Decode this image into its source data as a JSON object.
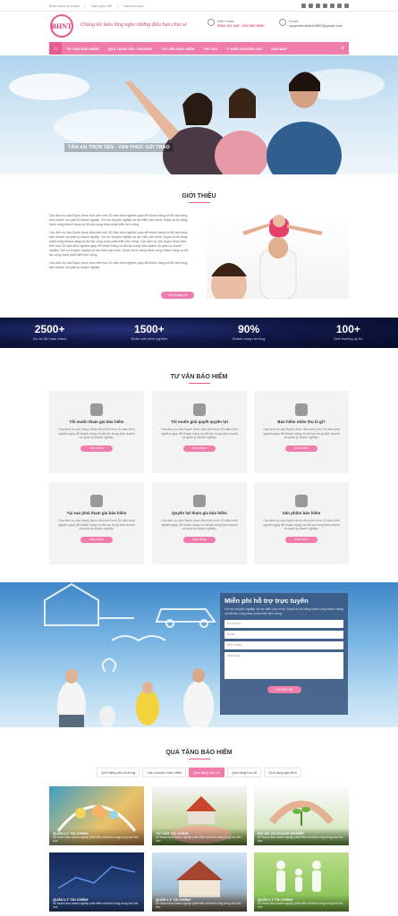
{
  "topbar": {
    "links": [
      "Định sách có thành",
      "Bảo gồm đổi",
      "Các tính sức"
    ]
  },
  "header": {
    "logo": "BHNT",
    "slogan": "Chúng tôi luôn lắng nghe những điều bạn chia sẻ",
    "phone_label": "Điện thoại:",
    "phone_value": "0962 141 108 - 063 800 9000",
    "email_label": "Email:",
    "email_value": "nguyenthuthanh2862@gmail.com"
  },
  "nav": {
    "items": [
      "TƯ VẤN BẢO HIỂM",
      "QUÀ TẶNG YÊU THƯƠNG",
      "TƯ LIỆU BẢO HIỂM",
      "TIN TỨC",
      "Ý KIẾN CHUYÊN GIA",
      "GIẢI ĐÁP"
    ]
  },
  "hero": {
    "caption": "TÂM AN TRỌN VẸN - VẠN PHÚC GỬI TRAO"
  },
  "intro": {
    "title": "GIỚI THIỆU",
    "p1": "Các dịch vụ của Suplo được đưa trên hơn 20 năm kinh nghiệm giúp để khách hàng và đối tác trong kinh doanh và quản lý doanh nghiệp. Với sự chuyên nghiệp và am hiểu của mình, Suplo tự tin đồng hành cùng khách hàng và đối tác cùng nhau phát triển bền vững.",
    "p2": "Các dịch vụ của Suplo được đưa trên hơn 20 năm kinh nghiệm giúp để khách hàng và đối tác trong kinh doanh và quản lý doanh nghiệp. Với sự chuyên nghiệp và am hiểu của mình, Suplo tự tin đồng hành cùng khách hàng và đối tác cùng nhau phát triển bền vững. Các dịch vụ của Suplo được đưa trên hơn 20 năm kinh nghiệm giúp để khách hàng và đối tác trong kinh doanh và quản lý doanh nghiệp. Với sự chuyên nghiệp và am hiểu của mình, Suplo tự tin đồng hành cùng khách hàng và đối tác cùng nhau phát triển bền vững.",
    "p3": "Các dịch vụ của Suplo được đưa trên hơn 20 năm kinh nghiệm giúp để khách hàng và đối tác trong kinh doanh và quản lý doanh nghiệp.",
    "button": "Về chúng tôi"
  },
  "stats": [
    {
      "num": "2500+",
      "label": "Dự án đã hoàn thành"
    },
    {
      "num": "1500+",
      "label": "Nhân viên kinh nghiệm"
    },
    {
      "num": "90%",
      "label": "Khách hàng hài lòng"
    },
    {
      "num": "100+",
      "label": "Giải thưởng uy tín"
    }
  ],
  "advice": {
    "title": "TƯ VẤN BẢO HIỂM",
    "desc": "Các dịch vụ của Suplo được đưa trên hơn 20 năm kinh nghiệm giúp để khách hàng và đối tác trong kinh doanh và quản lý doanh nghiệp.",
    "button": "Xem thêm",
    "cards": [
      {
        "title": "Tôi muốn tham gia bảo hiểm",
        "icon": "document-dollar-icon"
      },
      {
        "title": "Tôi muốn giải quyết quyền lợi",
        "icon": "shield-check-icon"
      },
      {
        "title": "Bảo hiểm nhân thọ là gì?",
        "icon": "chat-bubble-icon"
      },
      {
        "title": "Tại sao phải tham gia bảo hiểm",
        "icon": "question-circle-icon"
      },
      {
        "title": "Quyền lợi tham gia bảo hiểm",
        "icon": "clipboard-icon"
      },
      {
        "title": "Sản phẩm bảo hiểm",
        "icon": "shield-icon"
      }
    ]
  },
  "support": {
    "title": "Miễn phí hỗ trợ trực tuyến",
    "subtitle": "Với sự chuyên nghiệp và am hiểu của mình, Suplo tự tin đồng hành cùng khách hàng và đối tác cùng nhau phát triển bền vững.",
    "fields": [
      "Họ và tên",
      "Email",
      "Điện thoại",
      "Nội dung"
    ],
    "button": "Gửi liên hệ"
  },
  "gifts": {
    "title": "QUÀ TẶNG BẢO HIỂM",
    "tabs": [
      "Quà tặng yêu thương",
      "Câu chuyện bảo hiểm",
      "Quà tặng bảo vệ",
      "Quà tặng học tô",
      "Quà tặng gia đình"
    ],
    "tiles": [
      {
        "title": "QUẢN LÝ TÀI CHÍNH",
        "desc": "Kế hoạch đưa doanh nghiệp phát triển và thành công trong các lĩnh vực"
      },
      {
        "title": "TƯ VẤN TÀI CHÍNH",
        "desc": "Kế hoạch đưa doanh nghiệp phát triển và thành công trong các lĩnh vực"
      },
      {
        "title": "DỰ ÁN VÀ DOANH NGHIỆP",
        "desc": "Kế hoạch đưa doanh nghiệp phát triển và thành công trong các lĩnh vực"
      },
      {
        "title": "QUẢN LÝ TÀI CHÍNH",
        "desc": "Kế hoạch đưa doanh nghiệp phát triển và thành công trong các lĩnh vực"
      },
      {
        "title": "QUẢN LÝ TÀI CHÍNH",
        "desc": "Kế hoạch đưa doanh nghiệp phát triển và thành công trong các lĩnh vực"
      },
      {
        "title": "QUẢN LÝ TÀI CHÍNH",
        "desc": "Kế hoạch đưa doanh nghiệp phát triển và thành công trong các lĩnh vực"
      }
    ]
  },
  "colors": {
    "accent": "#f07cab",
    "brand": "#d23d74",
    "stats_bg": "#0b1240"
  }
}
